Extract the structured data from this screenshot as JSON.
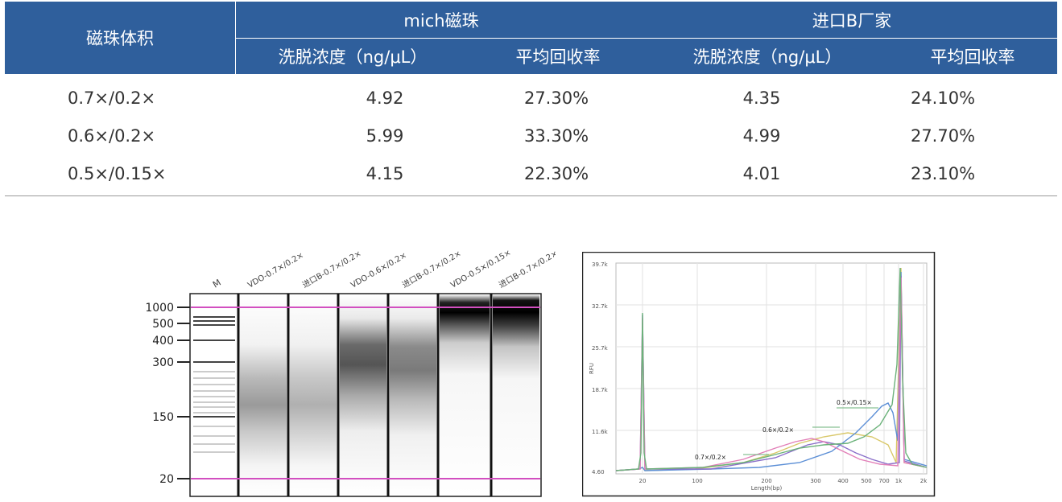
{
  "table": {
    "header_volume": "磁珠体积",
    "group_mich": "mich磁珠",
    "group_import": "进口B厂家",
    "col_conc": "洗脱浓度（ng/μL）",
    "col_recovery": "平均回收率",
    "rows": [
      {
        "volume": "0.7×/0.2×",
        "mich_conc": "4.92",
        "mich_rec": "27.30%",
        "imp_conc": "4.35",
        "imp_rec": "24.10%"
      },
      {
        "volume": "0.6×/0.2×",
        "mich_conc": "5.99",
        "mich_rec": "33.30%",
        "imp_conc": "4.99",
        "imp_rec": "27.70%"
      },
      {
        "volume": "0.5×/0.15×",
        "mich_conc": "4.15",
        "mich_rec": "22.30%",
        "imp_conc": "4.01",
        "imp_rec": "23.10%"
      }
    ]
  },
  "gel": {
    "lane_labels": [
      "M",
      "VDO-0.7×/0.2×",
      "进口B-0.7×/0.2×",
      "VDO-0.6×/0.2×",
      "进口B-0.7×/0.2×",
      "VDO-0.5×/0.15×",
      "进口B-0.7×/0.2×"
    ],
    "size_markers": [
      "1000",
      "500",
      "400",
      "300",
      "150",
      "20"
    ],
    "marker_color": "#d24fc0"
  },
  "electropherogram": {
    "y_label": "RFU",
    "x_label": "Length(bp)",
    "y_ticks": [
      "39.7k",
      "32.7k",
      "25.7k",
      "18.7k",
      "11.6k",
      "4.60"
    ],
    "x_ticks": [
      "20",
      "100",
      "200",
      "300",
      "400",
      "500",
      "700",
      "1k",
      "2k"
    ],
    "annotations": [
      "0.5×/0.15×",
      "0.6×/0.2×",
      "0.7×/0.2×"
    ],
    "series_colors": {
      "green": "#6bb27a",
      "pink": "#e27fb8",
      "blue": "#5c8fd6",
      "purple": "#8a6fc9",
      "yellow": "#d9c86a"
    }
  }
}
